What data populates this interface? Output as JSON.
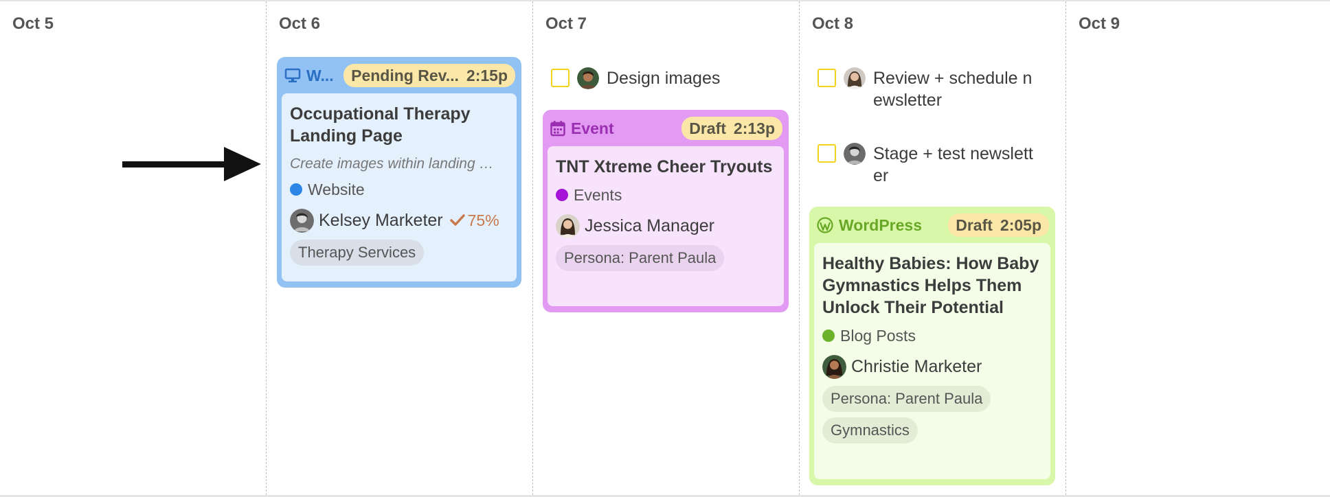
{
  "days": [
    {
      "label": "Oct 5"
    },
    {
      "label": "Oct 6"
    },
    {
      "label": "Oct 7"
    },
    {
      "label": "Oct 8"
    },
    {
      "label": "Oct 9"
    }
  ],
  "website_card": {
    "type_label": "W...",
    "status": "Pending Rev...",
    "time": "2:15p",
    "title": "Occupational Therapy Landing Page",
    "description": "Create images within landing …",
    "category": "Website",
    "assignee": "Kelsey Marketer",
    "progress": "75%",
    "tags": [
      "Therapy Services"
    ],
    "colors": {
      "border": "#92c1f4",
      "body": "#e5f0fd",
      "accent": "#2a6fc2",
      "dot": "#2b86e6"
    }
  },
  "event_card": {
    "type_label": "Event",
    "status": "Draft",
    "time": "2:13p",
    "title": "TNT Xtreme Cheer Tryouts",
    "category": "Events",
    "assignee": "Jessica Manager",
    "tags": [
      "Persona: Parent Paula"
    ],
    "colors": {
      "border": "#e39af2",
      "body": "#f8e3fc",
      "accent": "#9b2fb2",
      "dot": "#a612d6"
    }
  },
  "wordpress_card": {
    "type_label": "WordPress",
    "status": "Draft",
    "time": "2:05p",
    "title": "Healthy Babies: How Baby Gymnastics Helps Them Unlock Their Potential",
    "category": "Blog Posts",
    "assignee": "Christie Marketer",
    "tags": [
      "Persona: Parent Paula",
      "Gymnastics"
    ],
    "colors": {
      "border": "#d9f7a8",
      "body": "#f4fde7",
      "accent": "#69a827",
      "dot": "#6bb22a"
    }
  },
  "tasks": {
    "oct7": [
      {
        "label": "Design images"
      }
    ],
    "oct8": [
      {
        "label_line1": "Review + schedule n",
        "label_line2": "ewsletter"
      },
      {
        "label_line1": "Stage + test newslett",
        "label_line2": "er"
      }
    ]
  }
}
